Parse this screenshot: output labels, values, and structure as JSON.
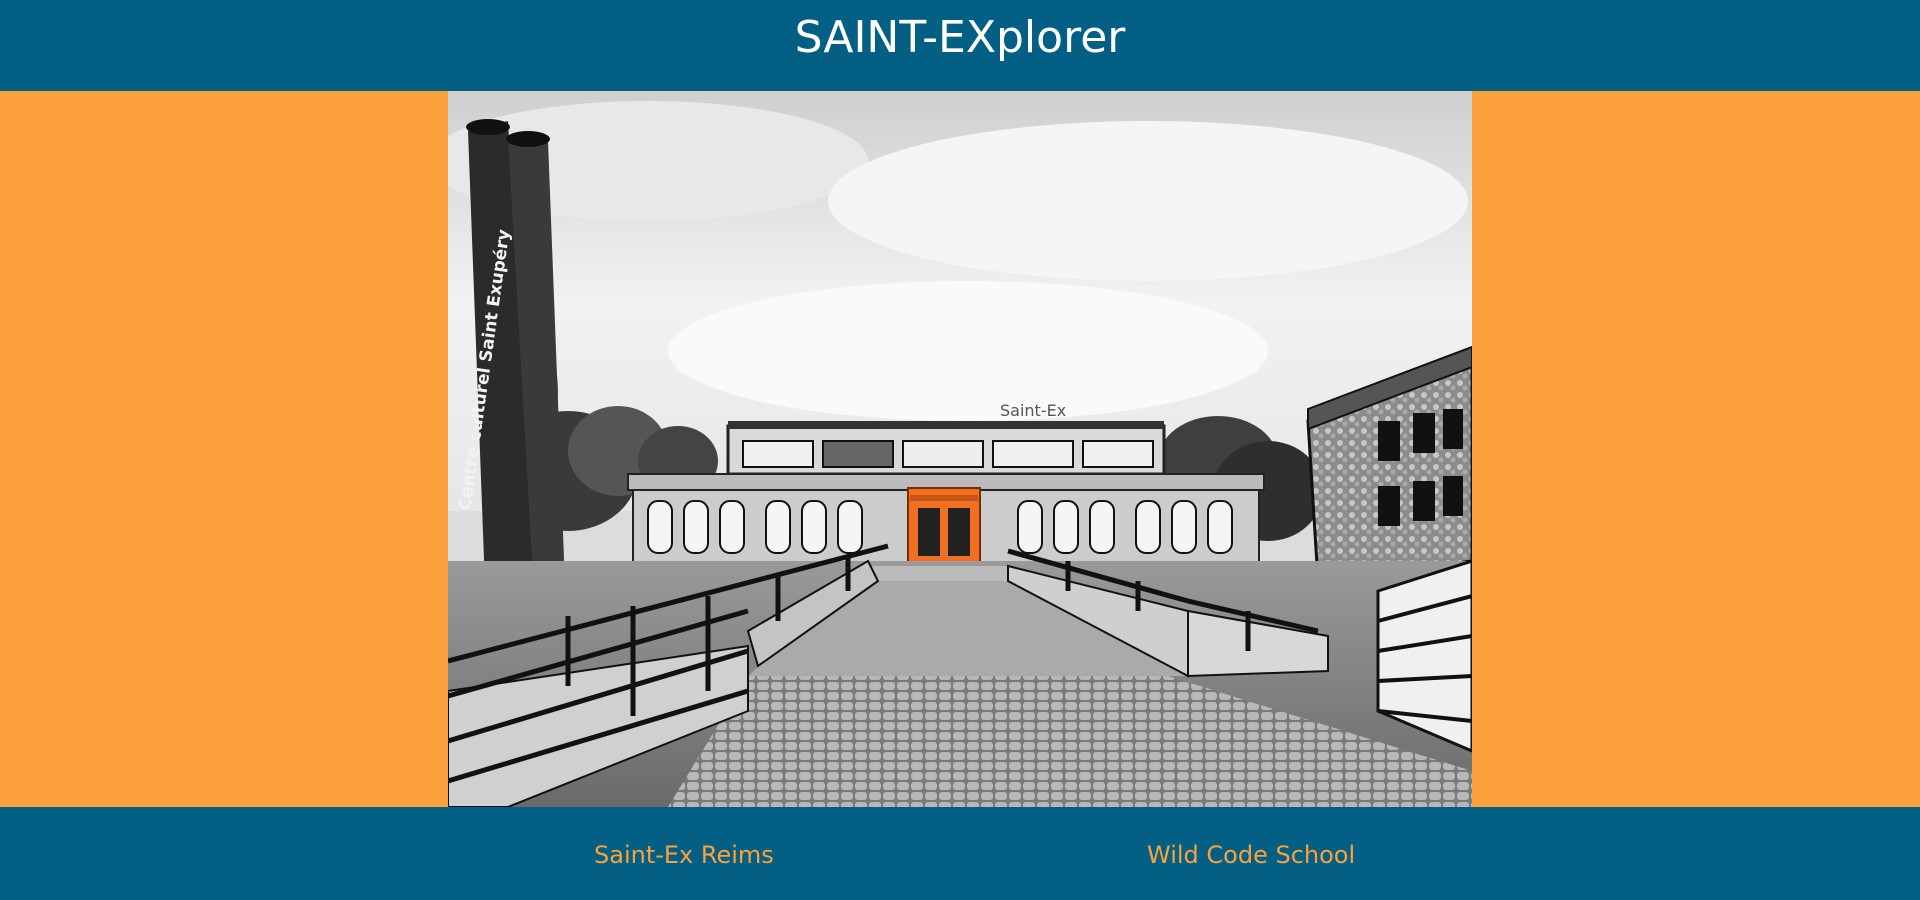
{
  "header": {
    "title": "SAINT-EXplorer"
  },
  "hero": {
    "tower_text": "Centre culturel Saint Exupéry",
    "roof_sign": "Saint-Ex"
  },
  "footer": {
    "links": [
      {
        "label": "Saint-Ex Reims"
      },
      {
        "label": "Wild Code School"
      }
    ]
  },
  "colors": {
    "header_bg": "#035F84",
    "page_bg": "#FBA03A",
    "title_text": "#FFFFFF",
    "link_text": "#FBA03A",
    "door_accent": "#F36F21"
  }
}
